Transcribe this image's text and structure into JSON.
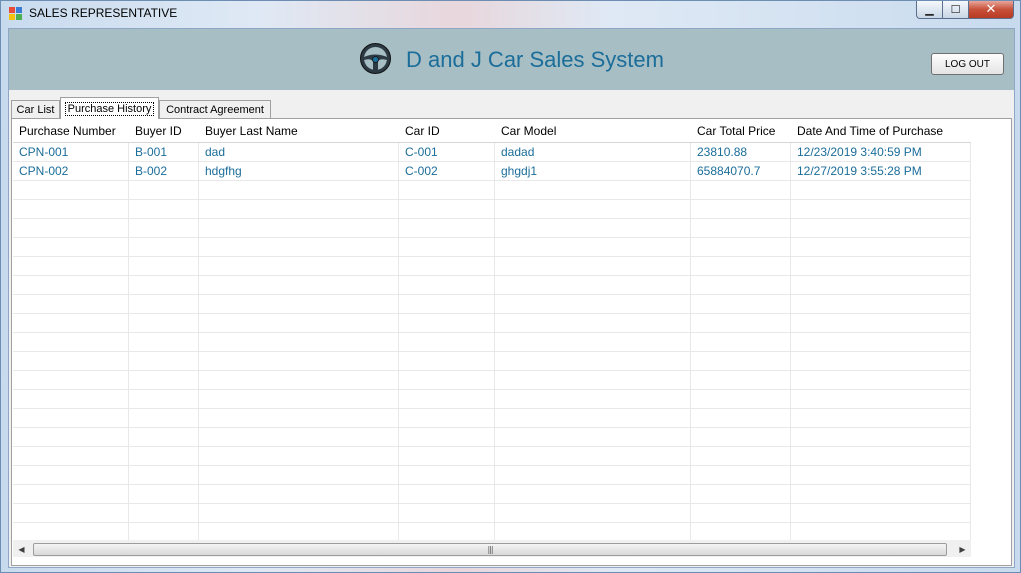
{
  "window": {
    "title": "SALES REPRESENTATIVE",
    "icon": "app-window-icon",
    "controls": {
      "minimize_icon": "minimize-icon",
      "maximize_icon": "maximize-icon",
      "close_icon": "close-icon",
      "minimize_glyph": "▁",
      "maximize_glyph": "☐",
      "close_glyph": "✕"
    }
  },
  "header": {
    "title": "D and J Car Sales System",
    "icon": "steering-wheel-icon",
    "logout_label": "LOG OUT",
    "background": "#a7bec4",
    "title_color": "#1b6d9a"
  },
  "tabs": [
    {
      "label": "Car List",
      "active": false
    },
    {
      "label": "Purchase History",
      "active": true
    },
    {
      "label": "Contract Agreement",
      "active": false
    }
  ],
  "grid": {
    "columns": [
      "Purchase Number",
      "Buyer ID",
      "Buyer Last Name",
      "Car ID",
      "Car Model",
      "Car Total Price",
      "Date And Time of Purchase"
    ],
    "rows": [
      [
        "CPN-001",
        "B-001",
        "dad",
        "C-001",
        "dadad",
        "23810.88",
        "12/23/2019 3:40:59 PM"
      ],
      [
        "CPN-002",
        "B-002",
        "hdgfhg",
        "C-002",
        "ghgdj1",
        "65884070.7",
        "12/27/2019 3:55:28 PM"
      ]
    ],
    "text_color": "#1b6d9a"
  },
  "scrollbar": {
    "left_arrow": "◀",
    "right_arrow": "▶",
    "grip": "|||"
  }
}
